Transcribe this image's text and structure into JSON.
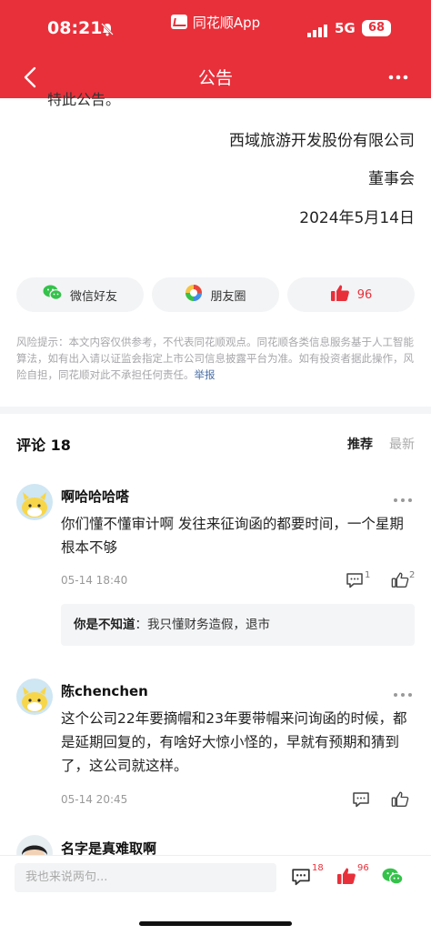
{
  "status_bar": {
    "time": "08:21",
    "app_name": "同花顺App",
    "network": "5G",
    "battery": "68"
  },
  "navbar": {
    "title": "公告"
  },
  "article": {
    "tail_text": "特此公告。",
    "company": "西域旅游开发股份有限公司",
    "board": "董事会",
    "date": "2024年5月14日"
  },
  "share": {
    "wechat_label": "微信好友",
    "moments_label": "朋友圈",
    "like_count": "96"
  },
  "risk": {
    "text": "风险提示：本文内容仅供参考，不代表同花顺观点。同花顺各类信息服务基于人工智能算法，如有出入请以证监会指定上市公司信息披露平台为准。如有投资者据此操作，风险自担，同花顺对此不承担任何责任。",
    "report_link": "举报"
  },
  "comments_section": {
    "title": "评论 18",
    "sort_recommended": "推荐",
    "sort_latest": "最新"
  },
  "comments": [
    {
      "user": "啊哈哈哈嗒",
      "text": "你们懂不懂审计啊 发往来征询函的都要时间，一个星期根本不够",
      "time": "05-14 18:40",
      "reply_count": "1",
      "like_count": "2",
      "reply": {
        "user": "你是不知道",
        "separator": "：",
        "text": "我只懂财务造假，退市"
      }
    },
    {
      "user": "陈chenchen",
      "text": "这个公司22年要摘帽和23年要带帽来问询函的时候，都是延期回复的，有啥好大惊小怪的，早就有预期和猜到了，这公司就这样。",
      "time": "05-14 20:45"
    },
    {
      "user": "名字是真难取啊"
    }
  ],
  "bottom_bar": {
    "placeholder": "我也来说两句...",
    "comment_count": "18",
    "like_count": "96"
  },
  "colors": {
    "brand_red": "#e8303a",
    "wechat_green": "#34c24a"
  }
}
